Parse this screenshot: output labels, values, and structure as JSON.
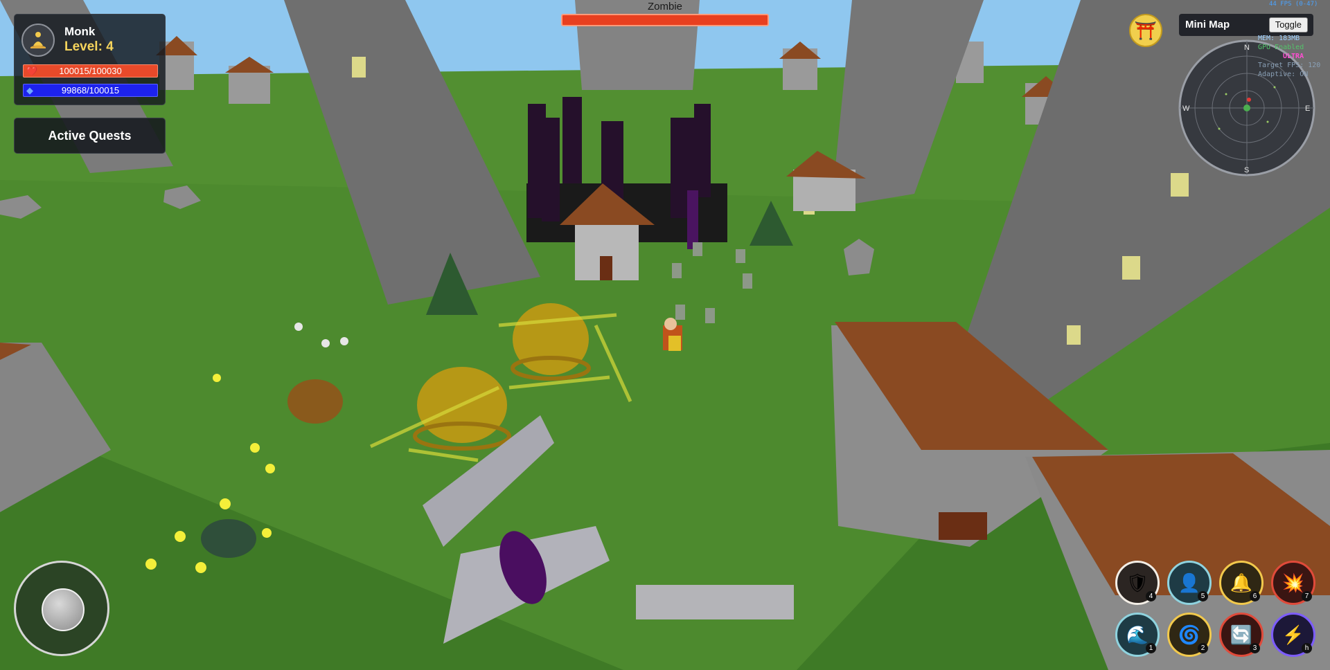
{
  "player": {
    "name": "Monk",
    "level": "Level: 4",
    "hp": "100015/100030",
    "hp_fraction": 0.9997,
    "mp": "99868/100015",
    "mp_fraction": 0.9985,
    "avatar_icon": "meditating-monk-icon"
  },
  "quests": {
    "label": "Active Quests"
  },
  "target": {
    "name": "Zombie",
    "health_fraction": 1.0
  },
  "minimap": {
    "title": "Mini Map",
    "toggle_label": "Toggle",
    "compass": {
      "n": "N",
      "s": "S",
      "e": "E",
      "w": "W"
    }
  },
  "temple_button": {
    "icon": "torii-gate-icon"
  },
  "perf": {
    "fps": "44 FPS (0-47)",
    "mem": "MEM: 183MB",
    "gpu": "GPU Enabled",
    "quality": "ULTRA",
    "target_fps": "Target FPS: 120",
    "adaptive": "Adaptive: ON"
  },
  "skills": [
    {
      "key": "4",
      "icon": "shield-icon",
      "color": "#f3eee6"
    },
    {
      "key": "5",
      "icon": "silhouette-icon",
      "color": "#8fd3df"
    },
    {
      "key": "6",
      "icon": "bell-icon",
      "color": "#f2c94c"
    },
    {
      "key": "7",
      "icon": "explosion-icon",
      "color": "#e04a3a"
    },
    {
      "key": "1",
      "icon": "wave-icon",
      "color": "#8fd3df"
    },
    {
      "key": "2",
      "icon": "spiral-icon",
      "color": "#f2c94c"
    },
    {
      "key": "3",
      "icon": "cycle-icon",
      "color": "#e04a3a"
    },
    {
      "key": "h",
      "icon": "lightning-icon",
      "color": "#7c5cff"
    }
  ],
  "colors": {
    "hp": "#e84a2a",
    "mp": "#1d22ee",
    "grass": "#4d8a2e",
    "sky": "#8fc7ef",
    "bell": "#d2a414"
  }
}
